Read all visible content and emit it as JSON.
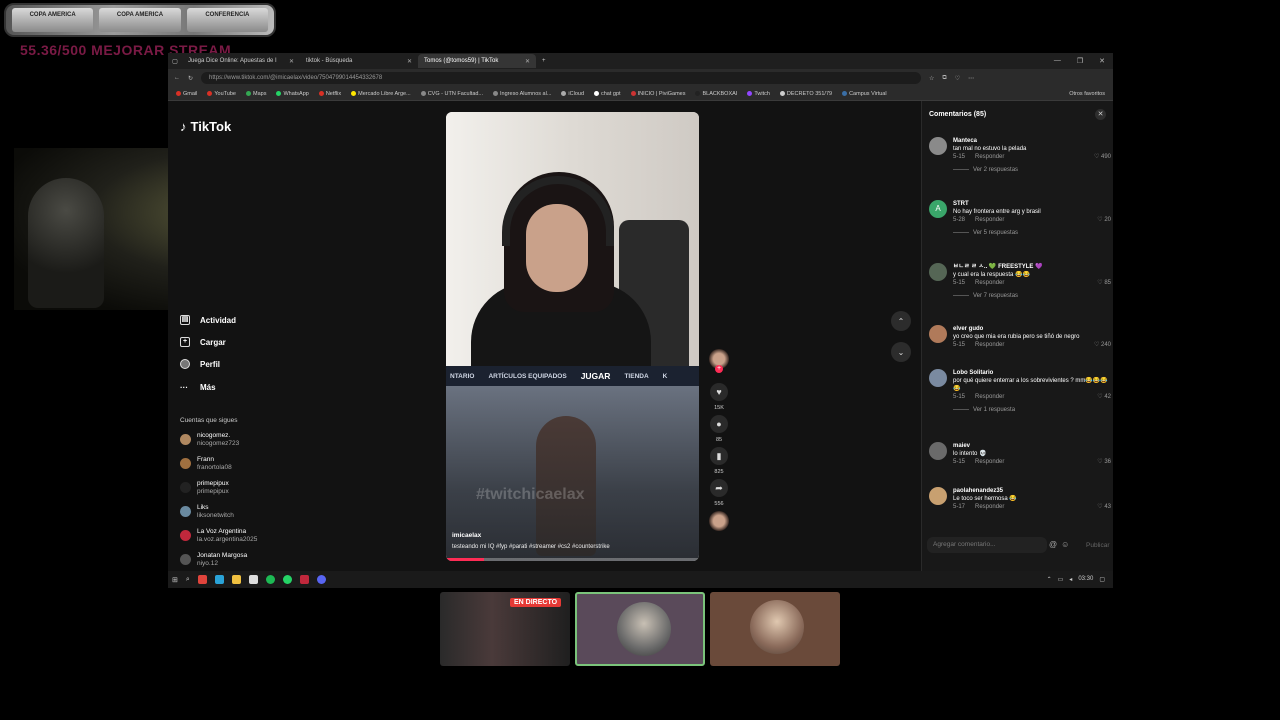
{
  "overlay": {
    "banner_cards": [
      "COPA AMERICA",
      "COPA AMERICA",
      "CONFERENCIA"
    ],
    "stream_goal": "55.36/500 MEJORAR STREAM"
  },
  "browser": {
    "tabs": [
      {
        "label": "Juega Dice Online: Apuestas de I",
        "close": "✕"
      },
      {
        "label": "tiktok - Búsqueda",
        "close": "✕"
      },
      {
        "label": "Tomos (@tomos59) | TikTok",
        "close": "✕"
      }
    ],
    "new_tab": "+",
    "window_controls": [
      "—",
      "❐",
      "✕"
    ],
    "url": "https://www.tiktok.com/@imicaelax/video/7504799014454332678",
    "bookmarks": [
      "Gmail",
      "YouTube",
      "Maps",
      "WhatsApp",
      "Netflix",
      "Mercado Libre Arge...",
      "CVG - UTN Facultad...",
      "Ingreso Alumnos al...",
      "iCloud",
      "chat gpt",
      "INICIO | PiviGames",
      "BLACKBOXAI",
      "Twitch",
      "DECRETO 351/79",
      "Campus Virtual"
    ],
    "other_bookmarks": "Otros favoritos"
  },
  "tiktok": {
    "logo": "TikTok",
    "nav": [
      "Actividad",
      "Cargar",
      "Perfil",
      "Más"
    ],
    "following_title": "Cuentas que sigues",
    "following": [
      {
        "name": "nicogomez.",
        "handle": "nicogomez723"
      },
      {
        "name": "Frann",
        "handle": "franortola08"
      },
      {
        "name": "primepipux",
        "handle": "primepipux"
      },
      {
        "name": "Liks",
        "handle": "liksonetwitch"
      },
      {
        "name": "La Voz Argentina",
        "handle": "la.voz.argentina2025"
      },
      {
        "name": "Jonatan Margosa",
        "handle": "niyo.12"
      }
    ],
    "video": {
      "game_menu": [
        "NTARIO",
        "ARTÍCULOS EQUIPADOS",
        "JUGAR",
        "TIENDA",
        "K"
      ],
      "watermark": "#twitchicaelax",
      "author": "imicaelax",
      "caption": "testeando mi IQ #fyp #parati #streamer #cs2 #counterstrike",
      "progress": 0.15
    },
    "actions": {
      "likes": "15K",
      "comments": "85",
      "saves": "825",
      "shares": "556"
    }
  },
  "comments": {
    "title": "Comentarios (85)",
    "reply_label": "Responder",
    "input_placeholder": "Agregar comentario...",
    "post_label": "Publicar",
    "items": [
      {
        "user": "Manteca",
        "text": "tan mal no estuvo la pelada",
        "date": "5-15",
        "likes": "490",
        "replies": "Ver 2 respuestas",
        "color": "#8a8a8a"
      },
      {
        "user": "STRT",
        "text": "No hay frontera entre arg y brasil",
        "date": "5-28",
        "likes": "20",
        "replies": "Ver 5 respuestas",
        "color": "#3aa66a",
        "initial": "A"
      },
      {
        "user": "ㅂㄴㄹ ㄹ ㅅ.. 💚 FREESTYLE 💜",
        "text": "y cual era la respuesta 😂😂",
        "date": "5-15",
        "likes": "85",
        "replies": "Ver 7 respuestas",
        "color": "#556655"
      },
      {
        "user": "elver gudo",
        "text": "yo creo que mia era rubia pero se tiñó de negro",
        "date": "5-15",
        "likes": "240",
        "replies": "",
        "color": "#b07a5a"
      },
      {
        "user": "Lobo Solitario",
        "text": "por qué quiere enterrar a los sobrevivientes ? mm😂😂😂😂",
        "date": "5-15",
        "likes": "42",
        "replies": "Ver 1 respuesta",
        "color": "#7a8aa0"
      },
      {
        "user": "maiev",
        "text": "lo intento 💀",
        "date": "5-15",
        "likes": "36",
        "replies": "",
        "color": "#6a6a6a"
      },
      {
        "user": "paolahenandez35",
        "text": "Le toco ser hermosa 😂",
        "date": "5-17",
        "likes": "43",
        "replies": "",
        "color": "#c8a070"
      }
    ]
  },
  "taskbar": {
    "time": "03:30"
  },
  "thumbnails": {
    "live_badge": "EN DIRECTO"
  }
}
